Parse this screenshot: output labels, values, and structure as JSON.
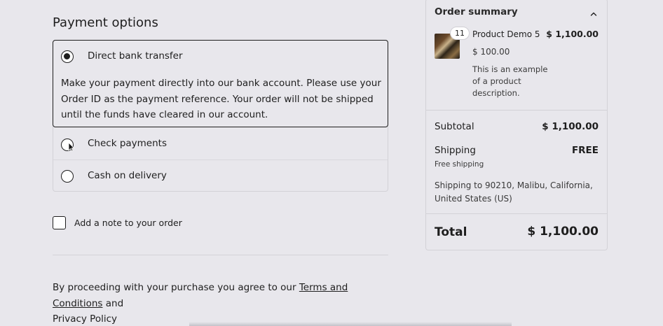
{
  "payment": {
    "title": "Payment options",
    "options": [
      {
        "label": "Direct bank transfer",
        "selected": true,
        "description": "Make your payment directly into our bank account. Please use your Order ID as the payment reference. Your order will not be shipped until the funds have cleared in our account."
      },
      {
        "label": "Check payments",
        "selected": false
      },
      {
        "label": "Cash on delivery",
        "selected": false
      }
    ]
  },
  "note": {
    "label": "Add a note to your order",
    "checked": false
  },
  "terms": {
    "prefix": "By proceeding with your purchase you agree to our ",
    "link1": "Terms and Conditions",
    "middle": " and ",
    "link2": "Privacy Policy"
  },
  "summary": {
    "title": "Order summary",
    "collapse_icon": "chevron-up-icon",
    "product": {
      "quantity": "11",
      "name": "Product Demo 5",
      "line_total": "$ 1,100.00",
      "unit_price": "$ 100.00",
      "description": "This is an example of a product description."
    },
    "subtotal_label": "Subtotal",
    "subtotal_value": "$ 1,100.00",
    "shipping_label": "Shipping",
    "shipping_value": "FREE",
    "shipping_method": "Free shipping",
    "shipping_address": "Shipping to 90210, Malibu, California, United States (US)",
    "total_label": "Total",
    "total_value": "$ 1,100.00"
  }
}
